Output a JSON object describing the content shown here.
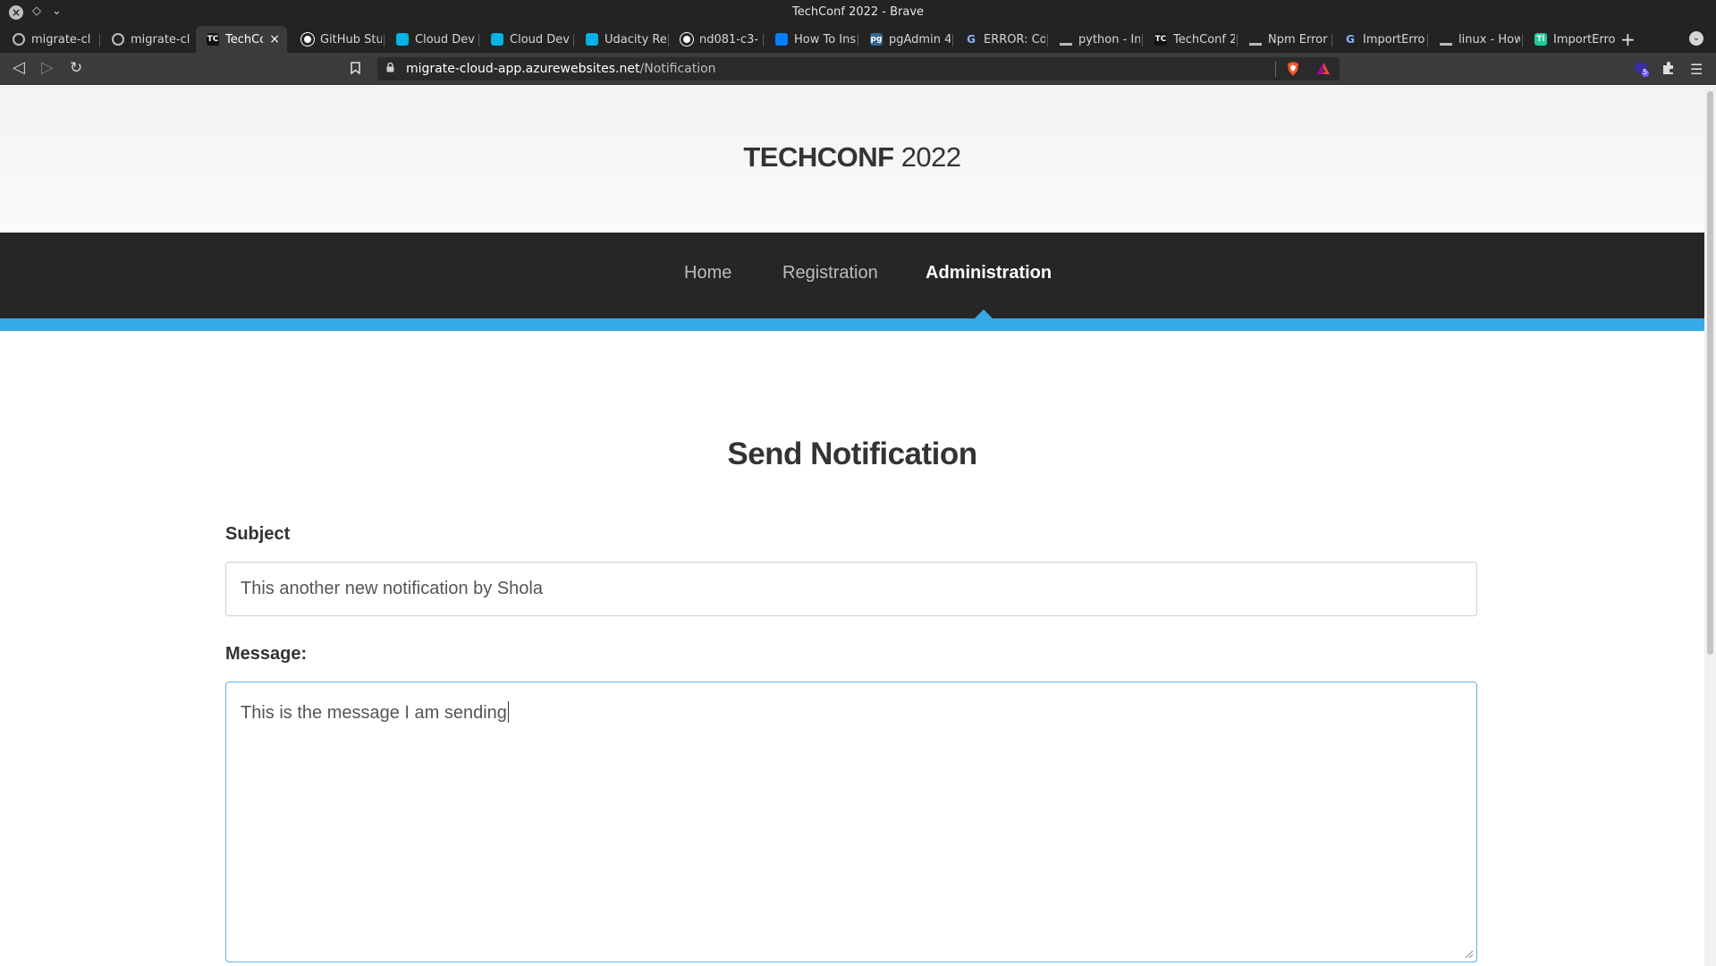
{
  "window": {
    "title": "TechConf 2022 - Brave"
  },
  "tabs": [
    {
      "label": "migrate-cl",
      "icon": "globe-icon",
      "favicon_color": "#5f6368"
    },
    {
      "label": "migrate-cl",
      "icon": "globe-icon",
      "favicon_color": "#5f6368"
    },
    {
      "label": "TechCo",
      "icon": "techconf-icon",
      "favicon_color": "#111111",
      "favicon_text": "TC",
      "active": true
    },
    {
      "label": "GitHub Stu",
      "icon": "github-icon",
      "favicon_color": "#ffffff"
    },
    {
      "label": "Cloud Dev",
      "icon": "udacity-icon",
      "favicon_color": "#02b3e4"
    },
    {
      "label": "Cloud Dev",
      "icon": "udacity-icon",
      "favicon_color": "#02b3e4"
    },
    {
      "label": "Udacity Re",
      "icon": "udacity-icon",
      "favicon_color": "#02b3e4"
    },
    {
      "label": "nd081-c3-",
      "icon": "github-icon",
      "favicon_color": "#ffffff"
    },
    {
      "label": "How To Ins",
      "icon": "digitalocean-icon",
      "favicon_color": "#0080ff"
    },
    {
      "label": "pgAdmin 4",
      "icon": "pgadmin-icon",
      "favicon_color": "#336791",
      "favicon_text": "pg"
    },
    {
      "label": "ERROR: Co",
      "icon": "google-icon",
      "favicon_color": "#4285f4",
      "favicon_text": "G"
    },
    {
      "label": "python - In",
      "icon": "stackoverflow-icon",
      "favicon_color": "#f48024"
    },
    {
      "label": "TechConf 2",
      "icon": "techconf-icon",
      "favicon_color": "#111111",
      "favicon_text": "TC"
    },
    {
      "label": "Npm Error",
      "icon": "stackoverflow-icon",
      "favicon_color": "#f48024"
    },
    {
      "label": "ImportErro",
      "icon": "google-icon",
      "favicon_color": "#4285f4",
      "favicon_text": "G"
    },
    {
      "label": "linux - How",
      "icon": "stackoverflow-icon",
      "favicon_color": "#f48024"
    },
    {
      "label": "ImportErro",
      "icon": "ti-icon",
      "favicon_color": "#20c997",
      "favicon_text": "Ti"
    }
  ],
  "address_bar": {
    "host": "migrate-cloud-app.azurewebsites.net",
    "path": "/Notification"
  },
  "toolbar": {
    "extension_badge": "5"
  },
  "site": {
    "brand_bold": "TECHCONF",
    "brand_year": "2022",
    "nav": [
      {
        "label": "Home"
      },
      {
        "label": "Registration"
      },
      {
        "label": "Administration",
        "active": true
      }
    ],
    "accent_color": "#37a9e4"
  },
  "form": {
    "heading": "Send Notification",
    "subject_label": "Subject",
    "subject_value": "This another new notification by Shola",
    "message_label": "Message:",
    "message_value": "This is the message I am sending"
  }
}
